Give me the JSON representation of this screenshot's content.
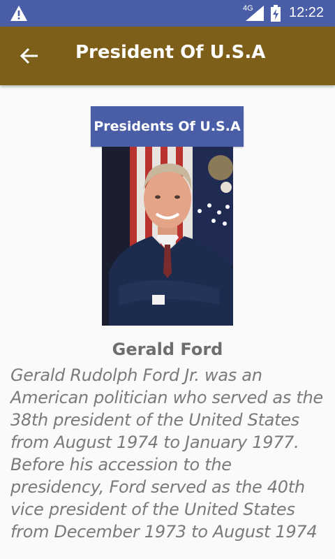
{
  "status_bar": {
    "network": "4G",
    "time": "12:22",
    "icons": [
      "warning-icon",
      "signal-icon",
      "battery-charging-icon"
    ]
  },
  "app_bar": {
    "title": "President Of U.S.A",
    "back_icon": "arrow-back-icon",
    "color": "#7d5f1a"
  },
  "content": {
    "header_button": "Presidents Of U.S.A",
    "portrait_alt": "Gerald Ford portrait",
    "name": "Gerald Ford",
    "bio": "Gerald Rudolph Ford Jr. was an American politician who served as the 38th president of the United States from August 1974 to January 1977. Before his accession to the presidency, Ford served as the 40th vice president of the United States from December 1973 to August 1974"
  },
  "colors": {
    "status_bar": "#4a5ea8",
    "app_bar": "#7d5f1a",
    "header_button": "#4a5ea8",
    "text": "#7a7a7a"
  }
}
